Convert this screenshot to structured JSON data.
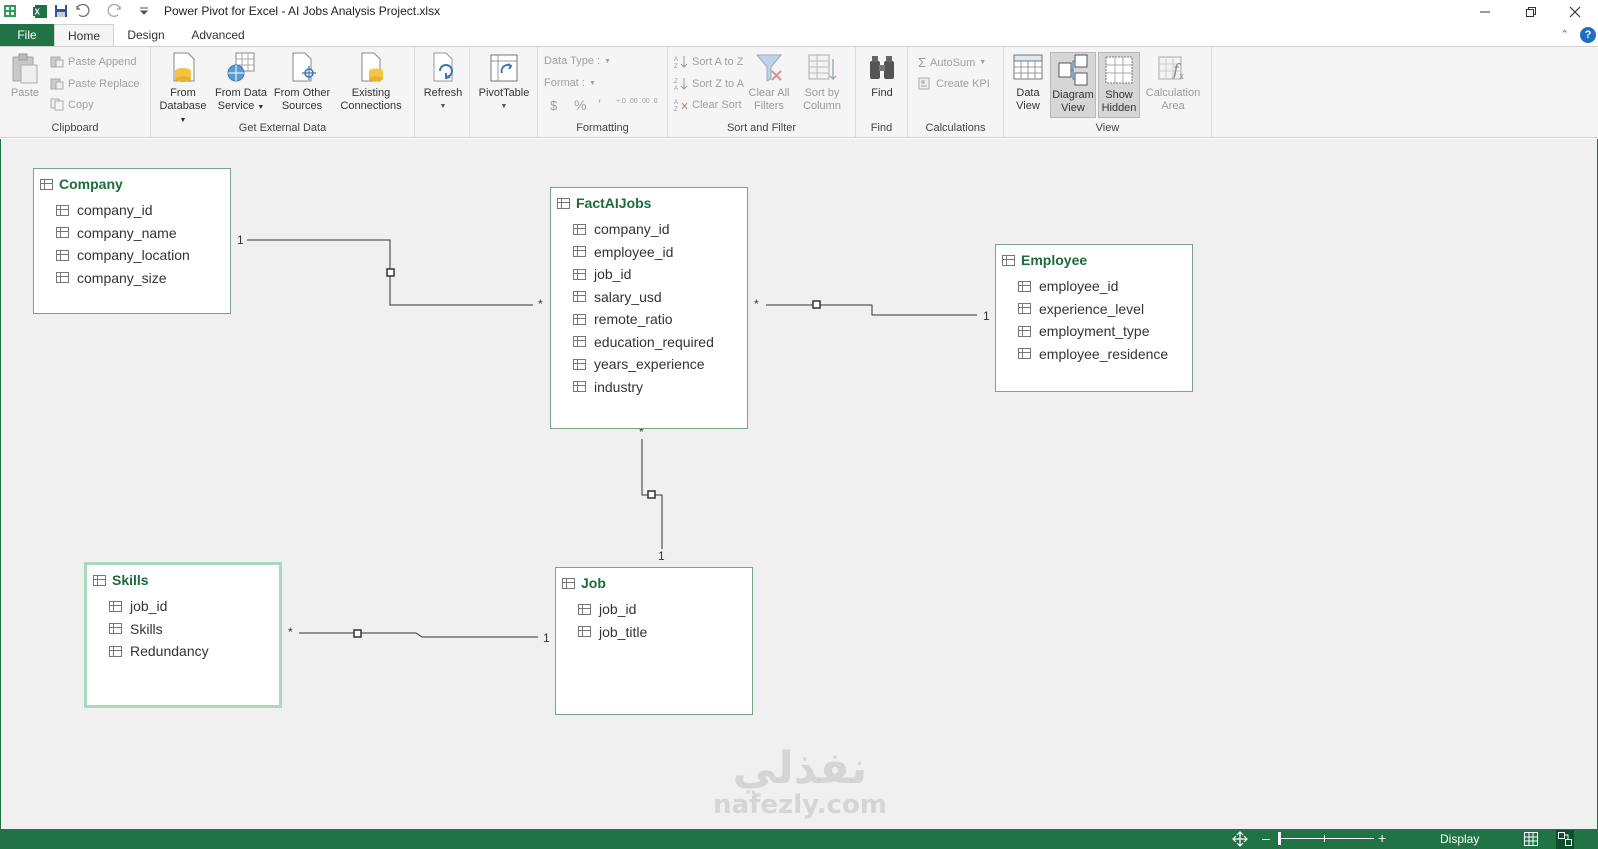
{
  "window": {
    "title": "Power Pivot for Excel - AI Jobs Analysis Project.xlsx",
    "minimize_icon": "minimize-icon",
    "restore_icon": "restore-icon",
    "close_icon": "close-icon",
    "help_label": "?"
  },
  "tabs": [
    {
      "label": "File"
    },
    {
      "label": "Home"
    },
    {
      "label": "Design"
    },
    {
      "label": "Advanced"
    }
  ],
  "ribbon": {
    "clipboard": {
      "group_label": "Clipboard",
      "paste": "Paste",
      "paste_append": "Paste Append",
      "paste_replace": "Paste Replace",
      "copy": "Copy"
    },
    "external": {
      "group_label": "Get External Data",
      "from_database_1": "From",
      "from_database_2": "Database",
      "from_data_service_1": "From Data",
      "from_data_service_2": "Service",
      "from_other_1": "From Other",
      "from_other_2": "Sources",
      "existing_1": "Existing",
      "existing_2": "Connections"
    },
    "refresh": "Refresh",
    "pivottable": "PivotTable",
    "formatting": {
      "group_label": "Formatting",
      "data_type": "Data Type :",
      "format": "Format :",
      "currency": "$",
      "percent": "%",
      "comma": "ʼ",
      "inc_dec": "+.0 .00",
      "dec_dec": ".00 .0"
    },
    "sort_filter": {
      "group_label": "Sort and Filter",
      "sort_az": "Sort A to Z",
      "sort_za": "Sort Z to A",
      "clear_sort": "Clear Sort",
      "clear_filters_1": "Clear All",
      "clear_filters_2": "Filters",
      "sort_by_1": "Sort by",
      "sort_by_2": "Column"
    },
    "find": {
      "group_label": "Find",
      "find": "Find"
    },
    "calculations": {
      "group_label": "Calculations",
      "autosum": "AutoSum",
      "create_kpi": "Create KPI"
    },
    "view": {
      "group_label": "View",
      "data_view_1": "Data",
      "data_view_2": "View",
      "diagram_view_1": "Diagram",
      "diagram_view_2": "View",
      "show_hidden_1": "Show",
      "show_hidden_2": "Hidden",
      "calc_area_1": "Calculation",
      "calc_area_2": "Area"
    }
  },
  "diagram": {
    "tables": {
      "company": {
        "name": "Company",
        "columns": [
          "company_id",
          "company_name",
          "company_location",
          "company_size"
        ]
      },
      "fact": {
        "name": "FactAIJobs",
        "columns": [
          "company_id",
          "employee_id",
          "job_id",
          "salary_usd",
          "remote_ratio",
          "education_required",
          "years_experience",
          "industry"
        ]
      },
      "employee": {
        "name": "Employee",
        "columns": [
          "employee_id",
          "experience_level",
          "employment_type",
          "employee_residence"
        ]
      },
      "skills": {
        "name": "Skills",
        "columns": [
          "job_id",
          "Skills",
          "Redundancy"
        ]
      },
      "job": {
        "name": "Job",
        "columns": [
          "job_id",
          "job_title"
        ]
      }
    },
    "cardinality": {
      "one": "1",
      "many": "*"
    }
  },
  "statusbar": {
    "display_label": "Display"
  },
  "watermark": {
    "arabic": "نفذلي",
    "latin": "nafezly.com"
  }
}
